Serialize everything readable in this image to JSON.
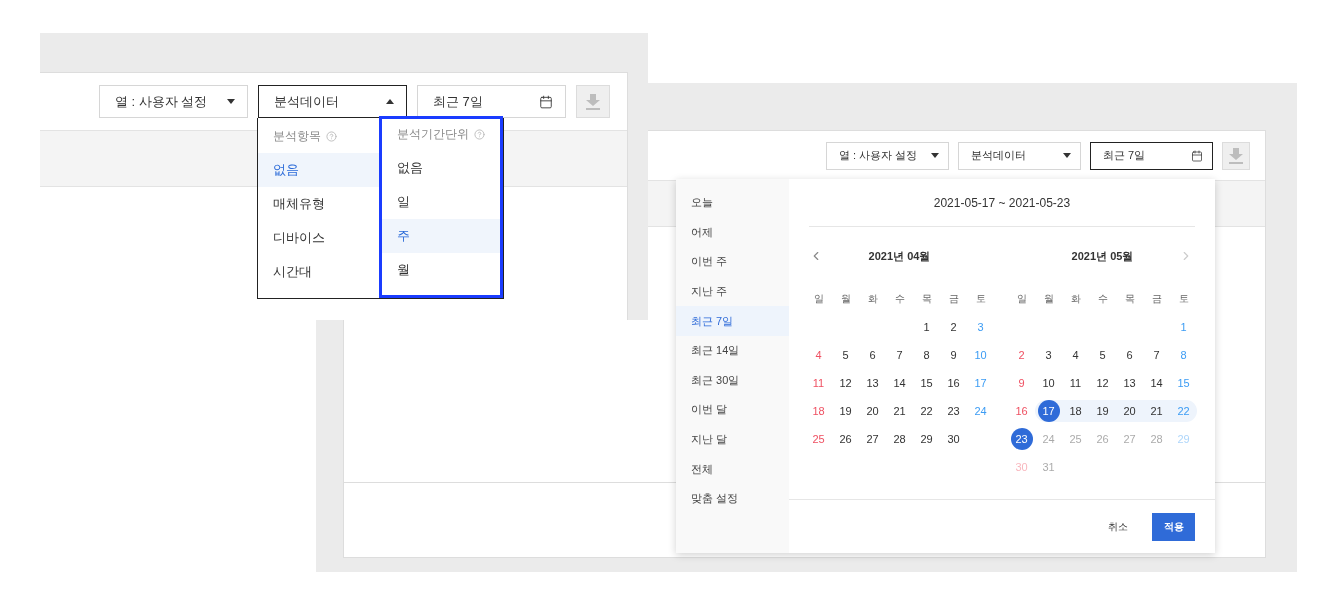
{
  "screens": [
    {
      "kind": "calendar-view",
      "toolbar": [
        {
          "kind": "select",
          "label": "열 : 사용자 설정",
          "open": false
        },
        {
          "kind": "select",
          "label": "분석데이터",
          "open": false
        },
        {
          "kind": "date",
          "label": "최근 7일",
          "open": true
        },
        {
          "kind": "download",
          "disabled": true
        }
      ],
      "date_picker": {
        "presets": [
          {
            "label": "오늘",
            "selected": false
          },
          {
            "label": "어제",
            "selected": false
          },
          {
            "label": "이번 주",
            "selected": false
          },
          {
            "label": "지난 주",
            "selected": false
          },
          {
            "label": "최근 7일",
            "selected": true
          },
          {
            "label": "최근 14일",
            "selected": false
          },
          {
            "label": "최근 30일",
            "selected": false
          },
          {
            "label": "이번 달",
            "selected": false
          },
          {
            "label": "지난 달",
            "selected": false
          },
          {
            "label": "전체",
            "selected": false
          },
          {
            "label": "맞춤 설정",
            "selected": false
          }
        ],
        "range": "2021-05-17 ~ 2021-05-23",
        "months": [
          {
            "title": "2021년 04월",
            "weekdays": [
              "일",
              "월",
              "화",
              "수",
              "목",
              "금",
              "토"
            ],
            "weeks": [
              [
                {
                  "kind": "blank"
                },
                {
                  "kind": "blank"
                },
                {
                  "kind": "blank"
                },
                {
                  "kind": "blank"
                },
                {
                  "day": "1",
                  "kind": "weekday",
                  "selected": false,
                  "in_range": false,
                  "disabled": false
                },
                {
                  "day": "2",
                  "kind": "weekday",
                  "selected": false,
                  "in_range": false,
                  "disabled": false
                },
                {
                  "day": "3",
                  "kind": "saturday",
                  "selected": false,
                  "in_range": false,
                  "disabled": false
                }
              ],
              [
                {
                  "day": "4",
                  "kind": "sunday",
                  "selected": false,
                  "in_range": false,
                  "disabled": false
                },
                {
                  "day": "5",
                  "kind": "weekday",
                  "selected": false,
                  "in_range": false,
                  "disabled": false
                },
                {
                  "day": "6",
                  "kind": "weekday",
                  "selected": false,
                  "in_range": false,
                  "disabled": false
                },
                {
                  "day": "7",
                  "kind": "weekday",
                  "selected": false,
                  "in_range": false,
                  "disabled": false
                },
                {
                  "day": "8",
                  "kind": "weekday",
                  "selected": false,
                  "in_range": false,
                  "disabled": false
                },
                {
                  "day": "9",
                  "kind": "weekday",
                  "selected": false,
                  "in_range": false,
                  "disabled": false
                },
                {
                  "day": "10",
                  "kind": "saturday",
                  "selected": false,
                  "in_range": false,
                  "disabled": false
                }
              ],
              [
                {
                  "day": "11",
                  "kind": "sunday",
                  "selected": false,
                  "in_range": false,
                  "disabled": false
                },
                {
                  "day": "12",
                  "kind": "weekday",
                  "selected": false,
                  "in_range": false,
                  "disabled": false
                },
                {
                  "day": "13",
                  "kind": "weekday",
                  "selected": false,
                  "in_range": false,
                  "disabled": false
                },
                {
                  "day": "14",
                  "kind": "weekday",
                  "selected": false,
                  "in_range": false,
                  "disabled": false
                },
                {
                  "day": "15",
                  "kind": "weekday",
                  "selected": false,
                  "in_range": false,
                  "disabled": false
                },
                {
                  "day": "16",
                  "kind": "weekday",
                  "selected": false,
                  "in_range": false,
                  "disabled": false
                },
                {
                  "day": "17",
                  "kind": "saturday",
                  "selected": false,
                  "in_range": false,
                  "disabled": false
                }
              ],
              [
                {
                  "day": "18",
                  "kind": "sunday",
                  "selected": false,
                  "in_range": false,
                  "disabled": false
                },
                {
                  "day": "19",
                  "kind": "weekday",
                  "selected": false,
                  "in_range": false,
                  "disabled": false
                },
                {
                  "day": "20",
                  "kind": "weekday",
                  "selected": false,
                  "in_range": false,
                  "disabled": false
                },
                {
                  "day": "21",
                  "kind": "weekday",
                  "selected": false,
                  "in_range": false,
                  "disabled": false
                },
                {
                  "day": "22",
                  "kind": "weekday",
                  "selected": false,
                  "in_range": false,
                  "disabled": false
                },
                {
                  "day": "23",
                  "kind": "weekday",
                  "selected": false,
                  "in_range": false,
                  "disabled": false
                },
                {
                  "day": "24",
                  "kind": "saturday",
                  "selected": false,
                  "in_range": false,
                  "disabled": false
                }
              ],
              [
                {
                  "day": "25",
                  "kind": "sunday",
                  "selected": false,
                  "in_range": false,
                  "disabled": false
                },
                {
                  "day": "26",
                  "kind": "weekday",
                  "selected": false,
                  "in_range": false,
                  "disabled": false
                },
                {
                  "day": "27",
                  "kind": "weekday",
                  "selected": false,
                  "in_range": false,
                  "disabled": false
                },
                {
                  "day": "28",
                  "kind": "weekday",
                  "selected": false,
                  "in_range": false,
                  "disabled": false
                },
                {
                  "day": "29",
                  "kind": "weekday",
                  "selected": false,
                  "in_range": false,
                  "disabled": false
                },
                {
                  "day": "30",
                  "kind": "weekday",
                  "selected": false,
                  "in_range": false,
                  "disabled": false
                },
                {
                  "kind": "blank"
                }
              ]
            ]
          },
          {
            "title": "2021년 05월",
            "weekdays": [
              "일",
              "월",
              "화",
              "수",
              "목",
              "금",
              "토"
            ],
            "weeks": [
              [
                {
                  "kind": "blank"
                },
                {
                  "kind": "blank"
                },
                {
                  "kind": "blank"
                },
                {
                  "kind": "blank"
                },
                {
                  "kind": "blank"
                },
                {
                  "kind": "blank"
                },
                {
                  "day": "1",
                  "kind": "saturday",
                  "selected": false,
                  "in_range": false,
                  "disabled": false
                }
              ],
              [
                {
                  "day": "2",
                  "kind": "sunday",
                  "selected": false,
                  "in_range": false,
                  "disabled": false
                },
                {
                  "day": "3",
                  "kind": "weekday",
                  "selected": false,
                  "in_range": false,
                  "disabled": false
                },
                {
                  "day": "4",
                  "kind": "weekday",
                  "selected": false,
                  "in_range": false,
                  "disabled": false
                },
                {
                  "day": "5",
                  "kind": "weekday",
                  "selected": false,
                  "in_range": false,
                  "disabled": false
                },
                {
                  "day": "6",
                  "kind": "weekday",
                  "selected": false,
                  "in_range": false,
                  "disabled": false
                },
                {
                  "day": "7",
                  "kind": "weekday",
                  "selected": false,
                  "in_range": false,
                  "disabled": false
                },
                {
                  "day": "8",
                  "kind": "saturday",
                  "selected": false,
                  "in_range": false,
                  "disabled": false
                }
              ],
              [
                {
                  "day": "9",
                  "kind": "sunday",
                  "selected": false,
                  "in_range": false,
                  "disabled": false
                },
                {
                  "day": "10",
                  "kind": "weekday",
                  "selected": false,
                  "in_range": false,
                  "disabled": false
                },
                {
                  "day": "11",
                  "kind": "weekday",
                  "selected": false,
                  "in_range": false,
                  "disabled": false
                },
                {
                  "day": "12",
                  "kind": "weekday",
                  "selected": false,
                  "in_range": false,
                  "disabled": false
                },
                {
                  "day": "13",
                  "kind": "weekday",
                  "selected": false,
                  "in_range": false,
                  "disabled": false
                },
                {
                  "day": "14",
                  "kind": "weekday",
                  "selected": false,
                  "in_range": false,
                  "disabled": false
                },
                {
                  "day": "15",
                  "kind": "saturday",
                  "selected": false,
                  "in_range": false,
                  "disabled": false
                }
              ],
              [
                {
                  "day": "16",
                  "kind": "sunday",
                  "selected": false,
                  "in_range": false,
                  "disabled": false
                },
                {
                  "day": "17",
                  "kind": "weekday",
                  "selected": true,
                  "in_range": true,
                  "disabled": false
                },
                {
                  "day": "18",
                  "kind": "weekday",
                  "selected": false,
                  "in_range": true,
                  "disabled": false
                },
                {
                  "day": "19",
                  "kind": "weekday",
                  "selected": false,
                  "in_range": true,
                  "disabled": false
                },
                {
                  "day": "20",
                  "kind": "weekday",
                  "selected": false,
                  "in_range": true,
                  "disabled": false
                },
                {
                  "day": "21",
                  "kind": "weekday",
                  "selected": false,
                  "in_range": true,
                  "disabled": false
                },
                {
                  "day": "22",
                  "kind": "saturday",
                  "selected": false,
                  "in_range": true,
                  "disabled": false
                }
              ],
              [
                {
                  "day": "23",
                  "kind": "sunday",
                  "selected": true,
                  "in_range": false,
                  "disabled": false
                },
                {
                  "day": "24",
                  "kind": "weekday",
                  "selected": false,
                  "in_range": false,
                  "disabled": true
                },
                {
                  "day": "25",
                  "kind": "weekday",
                  "selected": false,
                  "in_range": false,
                  "disabled": true
                },
                {
                  "day": "26",
                  "kind": "weekday",
                  "selected": false,
                  "in_range": false,
                  "disabled": true
                },
                {
                  "day": "27",
                  "kind": "weekday",
                  "selected": false,
                  "in_range": false,
                  "disabled": true
                },
                {
                  "day": "28",
                  "kind": "weekday",
                  "selected": false,
                  "in_range": false,
                  "disabled": true
                },
                {
                  "day": "29",
                  "kind": "saturday",
                  "selected": false,
                  "in_range": false,
                  "disabled": true
                }
              ],
              [
                {
                  "day": "30",
                  "kind": "sunday",
                  "selected": false,
                  "in_range": false,
                  "disabled": true
                },
                {
                  "day": "31",
                  "kind": "weekday",
                  "selected": false,
                  "in_range": false,
                  "disabled": true
                },
                {
                  "kind": "blank"
                },
                {
                  "kind": "blank"
                },
                {
                  "kind": "blank"
                },
                {
                  "kind": "blank"
                },
                {
                  "kind": "blank"
                }
              ]
            ]
          }
        ],
        "buttons": [
          {
            "label": "취소",
            "kind": "secondary"
          },
          {
            "label": "적용",
            "kind": "primary"
          }
        ]
      }
    },
    {
      "kind": "dropdown-view",
      "toolbar": [
        {
          "kind": "select",
          "label": "열 : 사용자 설정",
          "open": false
        },
        {
          "kind": "select",
          "label": "분석데이터",
          "open": true
        },
        {
          "kind": "date",
          "label": "최근 7일",
          "open": false
        },
        {
          "kind": "download",
          "disabled": true
        }
      ],
      "dropdown": {
        "columns": [
          {
            "header": "분석항목",
            "highlighted": false,
            "items": [
              {
                "label": "없음",
                "selected": true
              },
              {
                "label": "매체유형",
                "selected": false
              },
              {
                "label": "디바이스",
                "selected": false
              },
              {
                "label": "시간대",
                "selected": false
              }
            ]
          },
          {
            "header": "분석기간단위",
            "highlighted": true,
            "items": [
              {
                "label": "없음",
                "selected": false
              },
              {
                "label": "일",
                "selected": false
              },
              {
                "label": "주",
                "selected": true
              },
              {
                "label": "월",
                "selected": false
              }
            ]
          }
        ]
      }
    }
  ]
}
